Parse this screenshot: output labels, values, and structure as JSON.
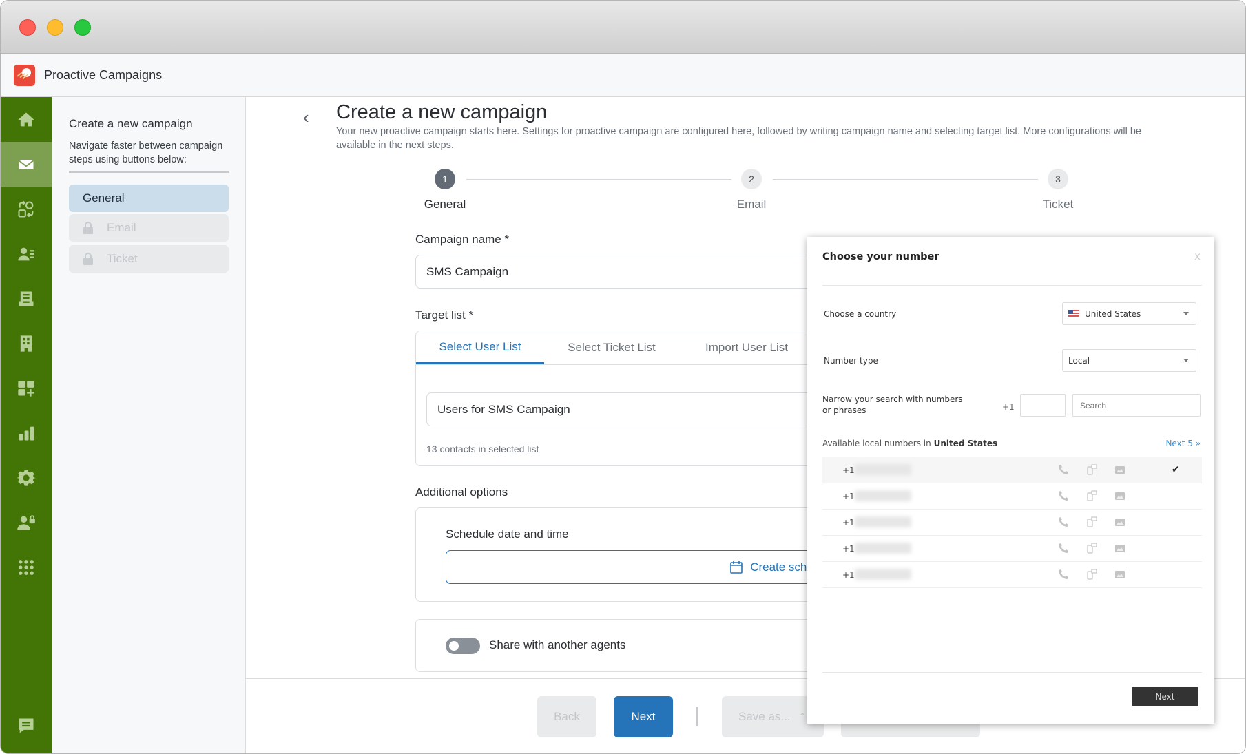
{
  "window": {
    "app_title": "Proactive Campaigns"
  },
  "rail": {
    "items": [
      {
        "icon": "home-icon",
        "label": "Home"
      },
      {
        "icon": "envelope-icon",
        "label": "Proactive Campaigns",
        "active": true
      },
      {
        "icon": "workflow-icon",
        "label": "Workflows"
      },
      {
        "icon": "contacts-icon",
        "label": "Contacts"
      },
      {
        "icon": "inbox-icon",
        "label": "Inbox"
      },
      {
        "icon": "building-icon",
        "label": "Companies"
      },
      {
        "icon": "add-widget-icon",
        "label": "Add-ons"
      },
      {
        "icon": "bar-chart-icon",
        "label": "Reports"
      },
      {
        "icon": "gear-icon",
        "label": "Settings"
      },
      {
        "icon": "user-lock-icon",
        "label": "Admin"
      },
      {
        "icon": "apps-grid-icon",
        "label": "Apps"
      },
      {
        "icon": "chat-icon",
        "label": "Chat"
      }
    ]
  },
  "sidebar": {
    "title": "Create a new campaign",
    "description": "Navigate faster between campaign steps using buttons below:",
    "steps": [
      {
        "label": "General",
        "active": true,
        "locked": false
      },
      {
        "label": "Email",
        "active": false,
        "locked": true
      },
      {
        "label": "Ticket",
        "active": false,
        "locked": true
      }
    ]
  },
  "main": {
    "back_icon": "chevron-left-icon",
    "title": "Create a new campaign",
    "subtitle": "Your new proactive campaign starts here. Settings for proactive campaign are configured here, followed by writing campaign name and selecting target list. More configurations will be available in the next steps.",
    "stepper": [
      {
        "number": "1",
        "label": "General",
        "active": true
      },
      {
        "number": "2",
        "label": "Email",
        "active": false
      },
      {
        "number": "3",
        "label": "Ticket",
        "active": false
      }
    ],
    "campaign_name": {
      "label": "Campaign name *",
      "value": "SMS Campaign"
    },
    "target_list": {
      "label": "Target list *",
      "tabs": [
        {
          "label": "Select User List",
          "active": true
        },
        {
          "label": "Select Ticket List",
          "active": false
        },
        {
          "label": "Import User List",
          "active": false
        }
      ],
      "selected_list": "Users for SMS Campaign",
      "contacts_hint": "13 contacts in selected list"
    },
    "additional_options": {
      "label": "Additional options",
      "schedule_label": "Schedule date and time",
      "schedule_button": "Create schedule",
      "share_label": "Share with another agents",
      "share_enabled": false
    },
    "footer": {
      "back": "Back",
      "next": "Next",
      "save_as": "Save as..."
    }
  },
  "modal": {
    "title": "Choose your number",
    "close": "x",
    "country_label": "Choose a country",
    "country_value": "United States",
    "number_type_label": "Number type",
    "number_type_value": "Local",
    "narrow_label": "Narrow your search with numbers or phrases",
    "prefix": "+1",
    "area_code_value": "",
    "search_placeholder": "Search",
    "available_prefix": "Available local numbers in",
    "available_country": "United States",
    "next5": "Next 5 »",
    "numbers": [
      {
        "prefix": "+1",
        "selected": true
      },
      {
        "prefix": "+1",
        "selected": false
      },
      {
        "prefix": "+1",
        "selected": false
      },
      {
        "prefix": "+1",
        "selected": false
      },
      {
        "prefix": "+1",
        "selected": false
      }
    ],
    "check_mark": "✔",
    "next_button": "Next"
  }
}
